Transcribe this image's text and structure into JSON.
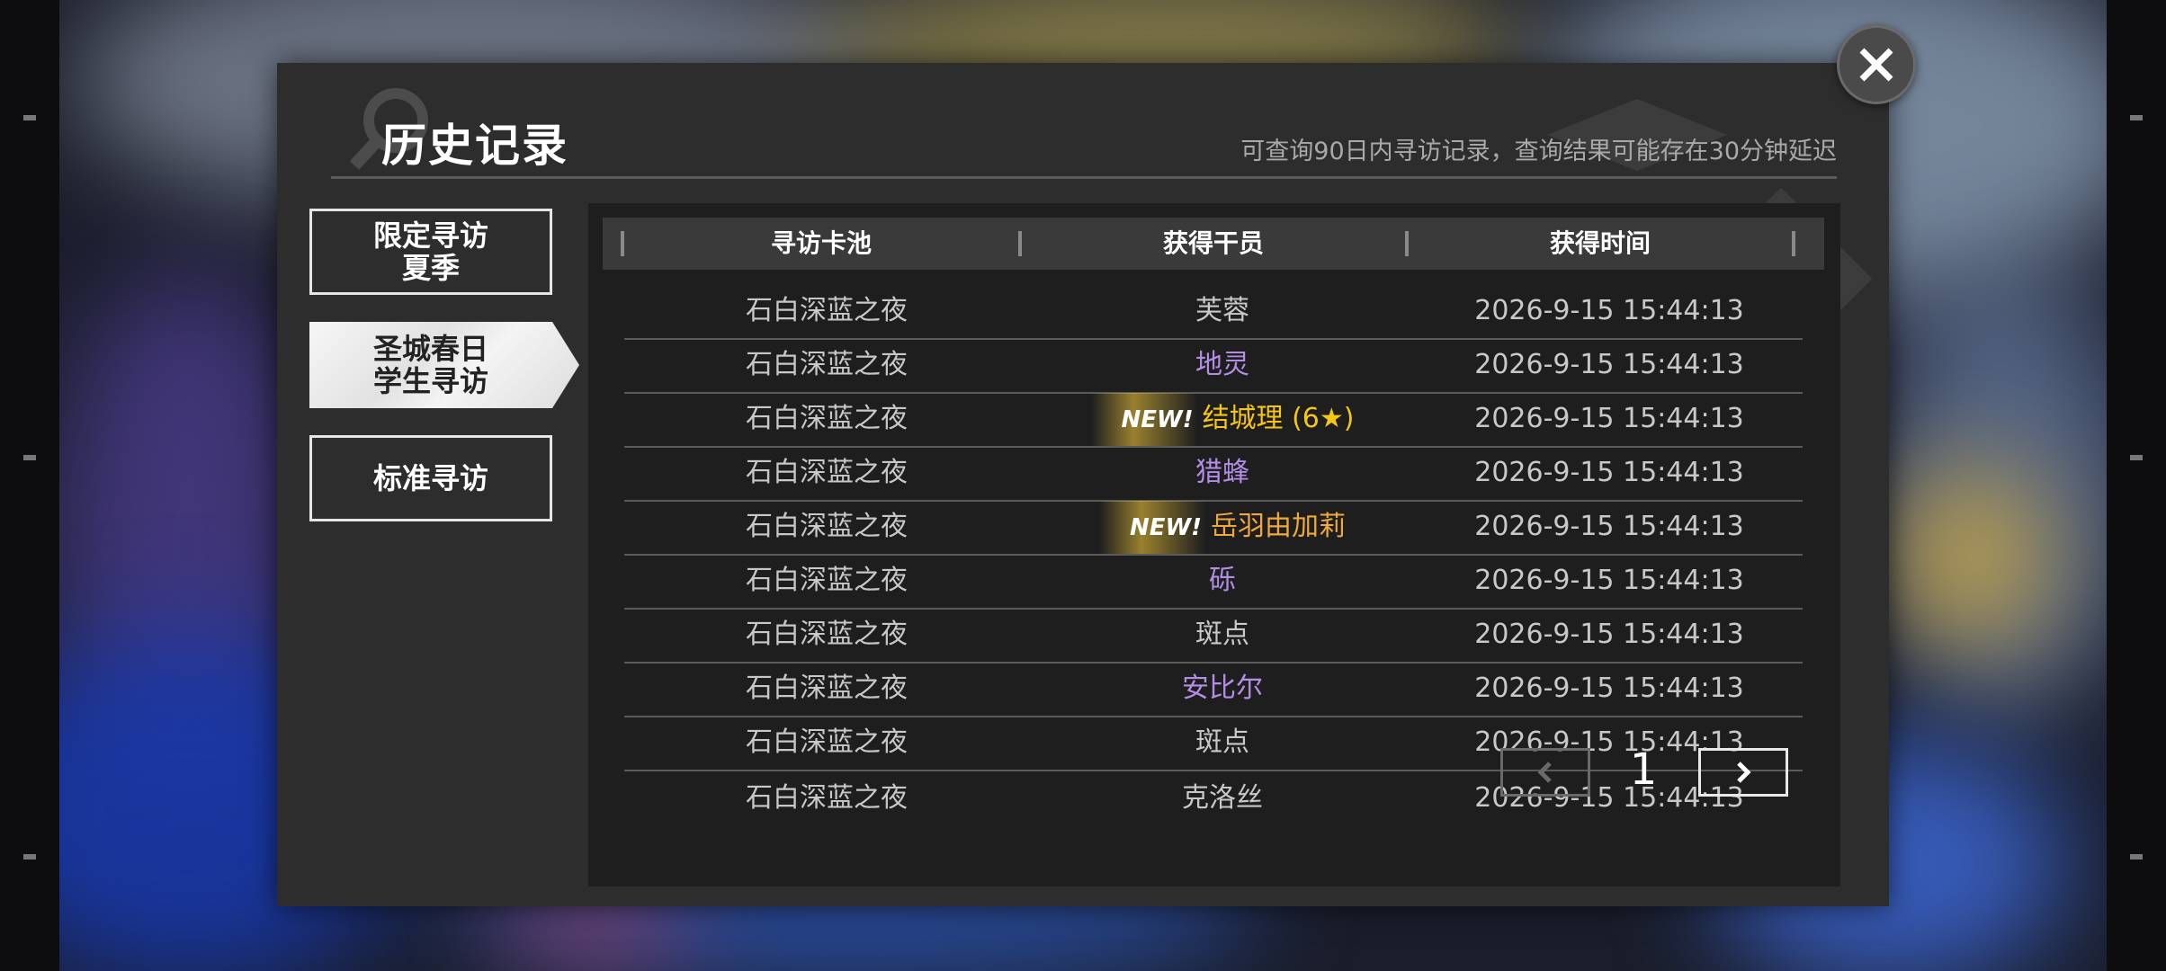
{
  "dialog": {
    "title": "历史记录",
    "hint": "可查询90日内寻访记录，查询结果可能存在30分钟延迟"
  },
  "tabs": [
    {
      "line1": "限定寻访",
      "line2": "夏季",
      "active": false
    },
    {
      "line1": "圣城春日",
      "line2": "学生寻访",
      "active": true
    },
    {
      "line1": "标准寻访",
      "line2": "",
      "active": false
    }
  ],
  "table": {
    "headers": [
      "寻访卡池",
      "获得干员",
      "获得时间"
    ],
    "rows": [
      {
        "pool": "石白深蓝之夜",
        "operator": "芙蓉",
        "new": "",
        "time": "2026-9-15 15:44:13",
        "color": "#c8c8c8"
      },
      {
        "pool": "石白深蓝之夜",
        "operator": "地灵",
        "new": "",
        "time": "2026-9-15 15:44:13",
        "color": "#b48ee6"
      },
      {
        "pool": "石白深蓝之夜",
        "operator": "结城理 (6★)",
        "new": "NEW!",
        "time": "2026-9-15 15:44:13",
        "color": "#f5c518"
      },
      {
        "pool": "石白深蓝之夜",
        "operator": "猎蜂",
        "new": "",
        "time": "2026-9-15 15:44:13",
        "color": "#b48ee6"
      },
      {
        "pool": "石白深蓝之夜",
        "operator": "岳羽由加莉",
        "new": "NEW!",
        "time": "2026-9-15 15:44:13",
        "color": "#f0a83c"
      },
      {
        "pool": "石白深蓝之夜",
        "operator": "砾",
        "new": "",
        "time": "2026-9-15 15:44:13",
        "color": "#b48ee6"
      },
      {
        "pool": "石白深蓝之夜",
        "operator": "斑点",
        "new": "",
        "time": "2026-9-15 15:44:13",
        "color": "#c8c8c8"
      },
      {
        "pool": "石白深蓝之夜",
        "operator": "安比尔",
        "new": "",
        "time": "2026-9-15 15:44:13",
        "color": "#b48ee6"
      },
      {
        "pool": "石白深蓝之夜",
        "operator": "斑点",
        "new": "",
        "time": "2026-9-15 15:44:13",
        "color": "#c8c8c8"
      },
      {
        "pool": "石白深蓝之夜",
        "operator": "克洛丝",
        "new": "",
        "time": "2026-9-15 15:44:13",
        "color": "#c8c8c8"
      }
    ]
  },
  "pagination": {
    "current": "1",
    "prev_icon": "chevron-left-icon",
    "next_icon": "chevron-right-icon"
  },
  "close_icon": "close-icon"
}
